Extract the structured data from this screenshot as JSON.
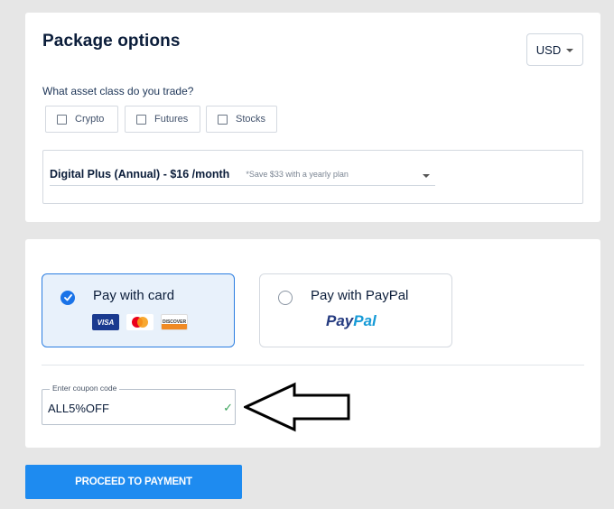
{
  "package": {
    "title": "Package options",
    "currency": "USD",
    "asset_question": "What asset class do you trade?",
    "asset_options": [
      {
        "label": "Crypto",
        "checked": false
      },
      {
        "label": "Futures",
        "checked": false
      },
      {
        "label": "Stocks",
        "checked": false
      }
    ],
    "plan": {
      "selected": "Digital Plus (Annual) - $16 /month",
      "note": "*Save $33 with a yearly plan"
    }
  },
  "payment": {
    "methods": [
      {
        "label": "Pay with card",
        "selected": true,
        "logos": [
          "VISA",
          "Mastercard",
          "DISCOVER"
        ]
      },
      {
        "label": "Pay with PayPal",
        "selected": false,
        "logo_parts": [
          "Pay",
          "Pal"
        ]
      }
    ],
    "coupon": {
      "label": "Enter coupon code",
      "value": "ALL5%OFF",
      "valid": true
    }
  },
  "proceed_label": "PROCEED TO PAYMENT",
  "colors": {
    "accent": "#1e8bf0",
    "selected_border": "#2a7de1",
    "selected_bg": "#e8f1fb",
    "valid_check": "#3aa35a",
    "background": "#e6e6e6"
  },
  "icons": {
    "currency_caret": "chevron-down-icon",
    "plan_caret": "chevron-down-icon",
    "card_radio": "check-circle-icon",
    "coupon_valid": "checkmark-icon",
    "annotation": "arrow-left-icon"
  }
}
